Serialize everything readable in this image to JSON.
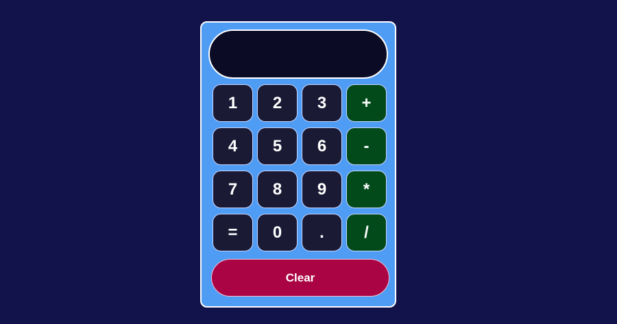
{
  "display": {
    "value": ""
  },
  "keypad": {
    "rows": [
      [
        "1",
        "2",
        "3",
        "+"
      ],
      [
        "4",
        "5",
        "6",
        "-"
      ],
      [
        "7",
        "8",
        "9",
        "*"
      ],
      [
        "=",
        "0",
        ".",
        "/"
      ]
    ]
  },
  "clear_label": "Clear",
  "colors": {
    "page_background": "#13134b",
    "calculator_body": "#4f9cf5",
    "display_background": "#0b0b26",
    "digit_key": "#1a1a35",
    "operator_key": "#034a1b",
    "clear_button": "#aa0444",
    "text": "#ffffff"
  }
}
